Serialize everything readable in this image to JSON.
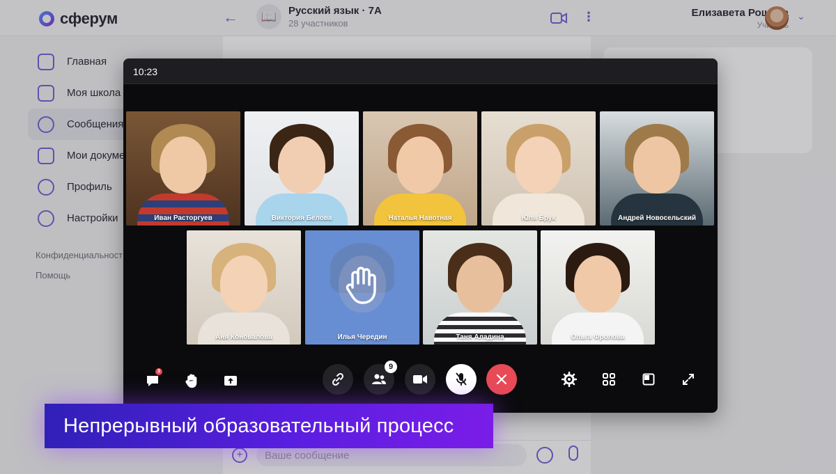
{
  "app": {
    "logo": "сферум",
    "chat": {
      "title": "Русский язык · 7А",
      "subtitle": "28 участников"
    },
    "user": {
      "name": "Елизавета Рощина",
      "role": "Учитель"
    },
    "sidebar": {
      "items": [
        {
          "label": "Главная",
          "icon": "home-grid-icon"
        },
        {
          "label": "Моя школа",
          "icon": "school-icon"
        },
        {
          "label": "Сообщения",
          "icon": "chat-bubble-icon"
        },
        {
          "label": "Мои документы",
          "icon": "document-icon"
        },
        {
          "label": "Профиль",
          "icon": "profile-icon"
        },
        {
          "label": "Настройки",
          "icon": "settings-gear-icon"
        }
      ],
      "footer_links": [
        "Конфиденциальность",
        "Помощь"
      ]
    },
    "composer": {
      "placeholder": "Ваше сообщение"
    }
  },
  "call": {
    "time": "10:23",
    "participants": [
      {
        "name": "Иван Расторгуев",
        "state": "normal"
      },
      {
        "name": "Виктория Белова",
        "state": "normal"
      },
      {
        "name": "Наталья Навотная",
        "state": "speaking"
      },
      {
        "name": "Юля Брук",
        "state": "normal"
      },
      {
        "name": "Андрей Новосельский",
        "state": "normal"
      },
      {
        "name": "Аня Коновалова",
        "state": "normal"
      },
      {
        "name": "Илья Чередин",
        "state": "hand-raised"
      },
      {
        "name": "Таня Аладина",
        "state": "normal"
      },
      {
        "name": "Ольга Фролова",
        "state": "normal"
      }
    ],
    "controls": {
      "chat_unread": "3",
      "participants_count": "9"
    },
    "colors": {
      "speaking_border": "#3fd24b",
      "end_call": "#e84a56",
      "brand": "#6a5bd6"
    }
  },
  "banner": {
    "text": "Непрерывный образовательный процесс"
  }
}
